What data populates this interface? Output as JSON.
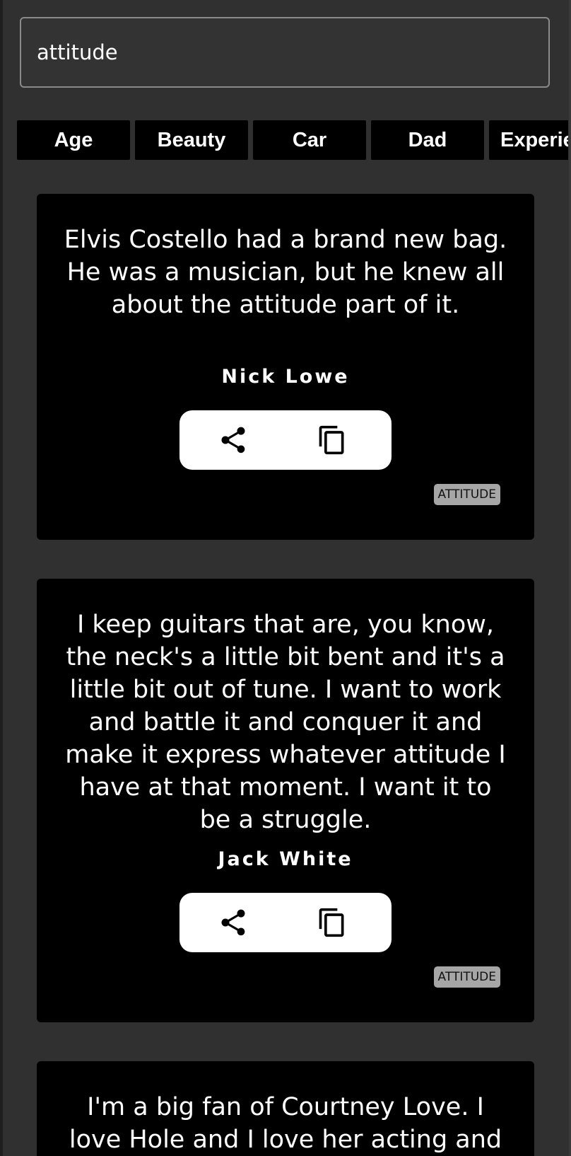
{
  "search": {
    "value": "attitude"
  },
  "categories": [
    "Age",
    "Beauty",
    "Car",
    "Dad",
    "Experie"
  ],
  "quotes": [
    {
      "text": "Elvis Costello had a brand new bag. He was a musician, but he knew all about the attitude part of it.",
      "author": "Nick Lowe",
      "tag": "ATTITUDE"
    },
    {
      "text": "I keep guitars that are, you know, the neck's a little bit bent and it's a little bit out of tune. I want to work and battle it and conquer it and make it express whatever attitude I have at that moment. I want it to be a struggle.",
      "author": "Jack White",
      "tag": "ATTITUDE"
    },
    {
      "text": "I'm a big fan of Courtney Love. I love Hole and I love her acting and"
    }
  ],
  "icons": {
    "share": "share-icon",
    "copy": "copy-icon"
  },
  "colors": {
    "background": "#303030",
    "card": "#000000",
    "text": "#ffffff",
    "tag_bg": "#a6a6a6",
    "actions_bg": "#ffffff"
  }
}
